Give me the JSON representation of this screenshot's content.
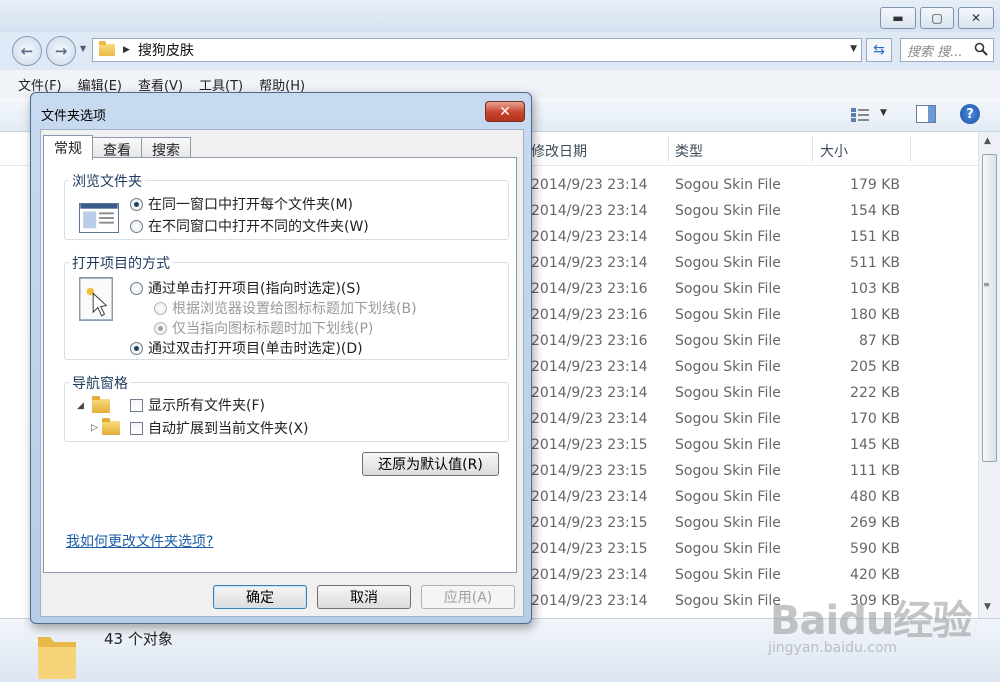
{
  "window": {
    "minimize_glyph": "▬",
    "maximize_glyph": "▢",
    "close_glyph": "✕"
  },
  "address": {
    "path_arrow": "▶",
    "folder_name": "搜狗皮肤",
    "search_placeholder": "搜索 搜..."
  },
  "menu": [
    "文件(F)",
    "编辑(E)",
    "查看(V)",
    "工具(T)",
    "帮助(H)"
  ],
  "columns": {
    "date": "修改日期",
    "type": "类型",
    "size": "大小"
  },
  "files": [
    {
      "date": "2014/9/23 23:14",
      "type": "Sogou Skin File",
      "size": "179 KB"
    },
    {
      "date": "2014/9/23 23:14",
      "type": "Sogou Skin File",
      "size": "154 KB"
    },
    {
      "date": "2014/9/23 23:14",
      "type": "Sogou Skin File",
      "size": "151 KB"
    },
    {
      "date": "2014/9/23 23:14",
      "type": "Sogou Skin File",
      "size": "511 KB"
    },
    {
      "date": "2014/9/23 23:16",
      "type": "Sogou Skin File",
      "size": "103 KB"
    },
    {
      "date": "2014/9/23 23:16",
      "type": "Sogou Skin File",
      "size": "180 KB"
    },
    {
      "date": "2014/9/23 23:16",
      "type": "Sogou Skin File",
      "size": "87 KB"
    },
    {
      "date": "2014/9/23 23:14",
      "type": "Sogou Skin File",
      "size": "205 KB"
    },
    {
      "date": "2014/9/23 23:14",
      "type": "Sogou Skin File",
      "size": "222 KB"
    },
    {
      "date": "2014/9/23 23:14",
      "type": "Sogou Skin File",
      "size": "170 KB"
    },
    {
      "date": "2014/9/23 23:15",
      "type": "Sogou Skin File",
      "size": "145 KB"
    },
    {
      "date": "2014/9/23 23:15",
      "type": "Sogou Skin File",
      "size": "111 KB"
    },
    {
      "date": "2014/9/23 23:14",
      "type": "Sogou Skin File",
      "size": "480 KB"
    },
    {
      "date": "2014/9/23 23:15",
      "type": "Sogou Skin File",
      "size": "269 KB"
    },
    {
      "date": "2014/9/23 23:15",
      "type": "Sogou Skin File",
      "size": "590 KB"
    },
    {
      "date": "2014/9/23 23:14",
      "type": "Sogou Skin File",
      "size": "420 KB"
    },
    {
      "date": "2014/9/23 23:14",
      "type": "Sogou Skin File",
      "size": "309 KB"
    }
  ],
  "status": {
    "count_text": "43 个对象"
  },
  "watermark": {
    "brand": "Baidu经验",
    "url": "jingyan.baidu.com"
  },
  "dialog": {
    "title": "文件夹选项",
    "tabs": [
      "常规",
      "查看",
      "搜索"
    ],
    "browse": {
      "title": "浏览文件夹",
      "same_window": "在同一窗口中打开每个文件夹(M)",
      "new_window": "在不同窗口中打开不同的文件夹(W)"
    },
    "click": {
      "title": "打开项目的方式",
      "single_click": "通过单击打开项目(指向时选定)(S)",
      "underline_browser": "根据浏览器设置给图标标题加下划线(B)",
      "underline_point": "仅当指向图标标题时加下划线(P)",
      "double_click": "通过双击打开项目(单击时选定)(D)"
    },
    "nav": {
      "title": "导航窗格",
      "show_all": "显示所有文件夹(F)",
      "auto_expand": "自动扩展到当前文件夹(X)"
    },
    "restore_defaults": "还原为默认值(R)",
    "help_link": "我如何更改文件夹选项?",
    "ok": "确定",
    "cancel": "取消",
    "apply": "应用(A)"
  },
  "colors": {
    "accent_blue": "#1a5ea8",
    "close_red": "#c8432c",
    "folder_yellow": "#e8b948"
  }
}
